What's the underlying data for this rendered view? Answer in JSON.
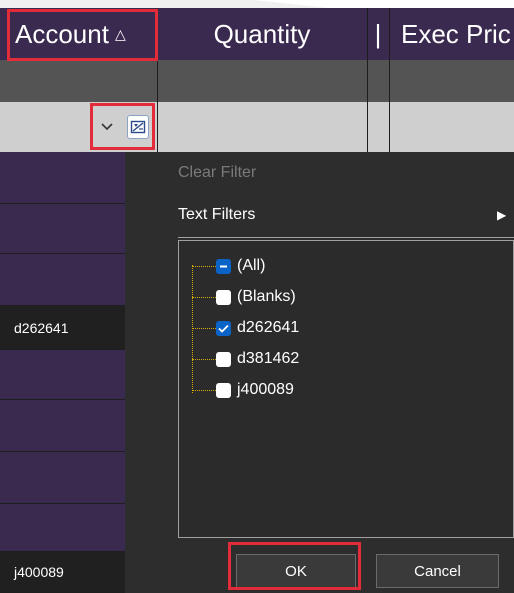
{
  "header": {
    "account_label": "Account",
    "sort_indicator": "△",
    "quantity_label": "Quantity",
    "separator_label": "|",
    "exec_price_label": "Exec Pric"
  },
  "left_rows": [
    {
      "text": ""
    },
    {
      "text": ""
    },
    {
      "text": ""
    },
    {
      "text": "d262641"
    },
    {
      "text": ""
    },
    {
      "text": ""
    },
    {
      "text": ""
    },
    {
      "text": ""
    },
    {
      "text": "j400089"
    }
  ],
  "filter_menu": {
    "clear_filter": "Clear Filter",
    "text_filters": "Text Filters",
    "submenu_arrow": "▶",
    "items": [
      {
        "label": "(All)",
        "state": "partial"
      },
      {
        "label": "(Blanks)",
        "state": "unchecked"
      },
      {
        "label": "d262641",
        "state": "checked"
      },
      {
        "label": "d381462",
        "state": "unchecked"
      },
      {
        "label": "j400089",
        "state": "unchecked"
      }
    ],
    "ok_label": "OK",
    "cancel_label": "Cancel"
  },
  "colors": {
    "header_bg": "#3b2a50",
    "highlight": "#e32c3a",
    "checkbox_checked": "#0a64c8"
  },
  "icons": {
    "dropdown": "chevron-down-icon",
    "filter": "filter-edit-icon"
  }
}
